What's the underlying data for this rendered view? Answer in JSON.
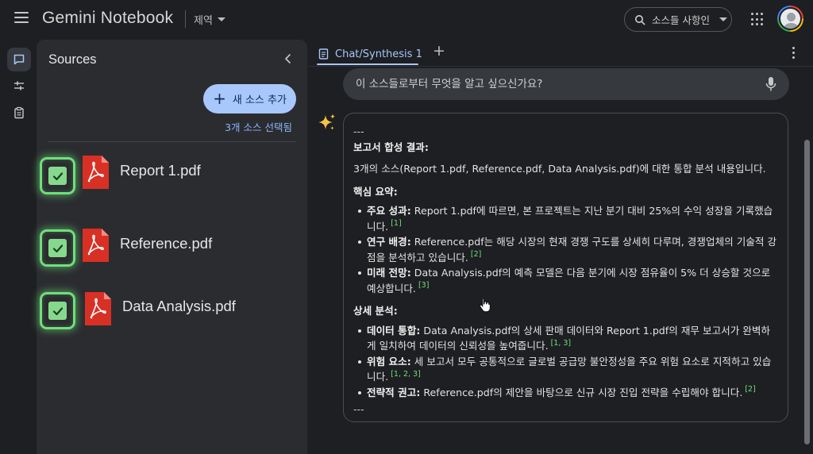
{
  "app": {
    "title": "Gemini Notebook",
    "subtitle": "제역"
  },
  "header": {
    "search_pill_label": "소스들 사항인"
  },
  "rail": {
    "items": [
      {
        "name": "chat-icon",
        "active": true
      },
      {
        "name": "sliders-icon",
        "active": false
      },
      {
        "name": "clipboard-icon",
        "active": false
      }
    ]
  },
  "sources": {
    "title": "Sources",
    "add_button_label": "새 소스 추가",
    "selected_count": "3개 소스 선택됨",
    "items": [
      {
        "name": "Report 1.pdf",
        "checked": true
      },
      {
        "name": "Reference.pdf",
        "checked": true
      },
      {
        "name": "Data Analysis.pdf",
        "checked": true
      }
    ]
  },
  "chat": {
    "tab_label": "Chat/Synthesis 1",
    "input_placeholder": "이 소스들로부터 무엇을 알고 싶으신가요?",
    "response": {
      "rule_top": "---",
      "heading": "보고서 합성 결과:",
      "intro": "3개의 소스(Report 1.pdf, Reference.pdf, Data Analysis.pdf)에 대한 통합 분석 내용입니다.",
      "summary_heading": "핵심 요약:",
      "summary_items": [
        {
          "label": "주요 성과:",
          "text": "Report 1.pdf에 따르면, 본 프로젝트는 지난 분기 대비 25%의 수익 성장을 기록했습니다.",
          "cite": "[1]"
        },
        {
          "label": "연구 배경:",
          "text": "Reference.pdf는 해당 시장의 현재 경쟁 구도를 상세히 다루며, 경쟁업체의 기술적 강점을 분석하고 있습니다.",
          "cite": "[2]"
        },
        {
          "label": "미래 전망:",
          "text": "Data Analysis.pdf의 예측 모델은 다음 분기에 시장 점유율이 5% 더 상승할 것으로 예상합니다.",
          "cite": "[3]"
        }
      ],
      "detail_heading": "상세 분석:",
      "detail_items": [
        {
          "label": "데이터 통합:",
          "text": "Data Analysis.pdf의 상세 판매 데이터와 Report 1.pdf의 재무 보고서가 완벽하게 일치하여 데이터의 신뢰성을 높여줍니다.",
          "cite": "[1, 3]"
        },
        {
          "label": "위험 요소:",
          "text": "세 보고서 모두 공통적으로 글로벌 공급망 불안정성을 주요 위험 요소로 지적하고 있습니다.",
          "cite": "[1, 2, 3]"
        },
        {
          "label": "전략적 권고:",
          "text": "Reference.pdf의 제안을 바탕으로 신규 시장 진입 전략을 수립해야 합니다.",
          "cite": "[2]"
        }
      ],
      "rule_bottom": "---"
    }
  },
  "colors": {
    "accent": "#a8c7fa",
    "check_green": "#6ee07a",
    "pdf_red": "#d93025",
    "background": "#1e1f22",
    "panel": "#2b2c30"
  }
}
